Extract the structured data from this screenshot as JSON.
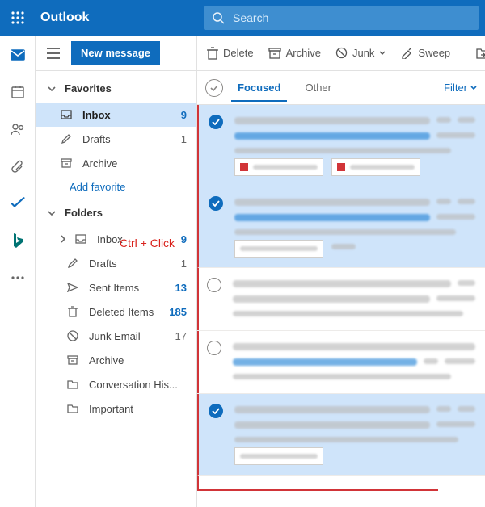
{
  "app": {
    "name": "Outlook"
  },
  "search": {
    "placeholder": "Search"
  },
  "newMessage": "New message",
  "toolbar": {
    "delete": "Delete",
    "archive": "Archive",
    "junk": "Junk",
    "sweep": "Sweep"
  },
  "sections": {
    "favorites": "Favorites",
    "folders": "Folders"
  },
  "favorites": {
    "inbox": {
      "label": "Inbox",
      "count": "9"
    },
    "drafts": {
      "label": "Drafts",
      "count": "1"
    },
    "archive": {
      "label": "Archive",
      "count": ""
    },
    "addFavorite": "Add favorite"
  },
  "folders": {
    "inbox": {
      "label": "Inbox",
      "count": "9"
    },
    "drafts": {
      "label": "Drafts",
      "count": "1"
    },
    "sent": {
      "label": "Sent Items",
      "count": "13"
    },
    "deleted": {
      "label": "Deleted Items",
      "count": "185"
    },
    "junk": {
      "label": "Junk Email",
      "count": "17"
    },
    "archive": {
      "label": "Archive",
      "count": ""
    },
    "convo": {
      "label": "Conversation His...",
      "count": ""
    },
    "important": {
      "label": "Important",
      "count": ""
    }
  },
  "hint": "Ctrl + Click",
  "tabs": {
    "focused": "Focused",
    "other": "Other"
  },
  "filter": "Filter"
}
